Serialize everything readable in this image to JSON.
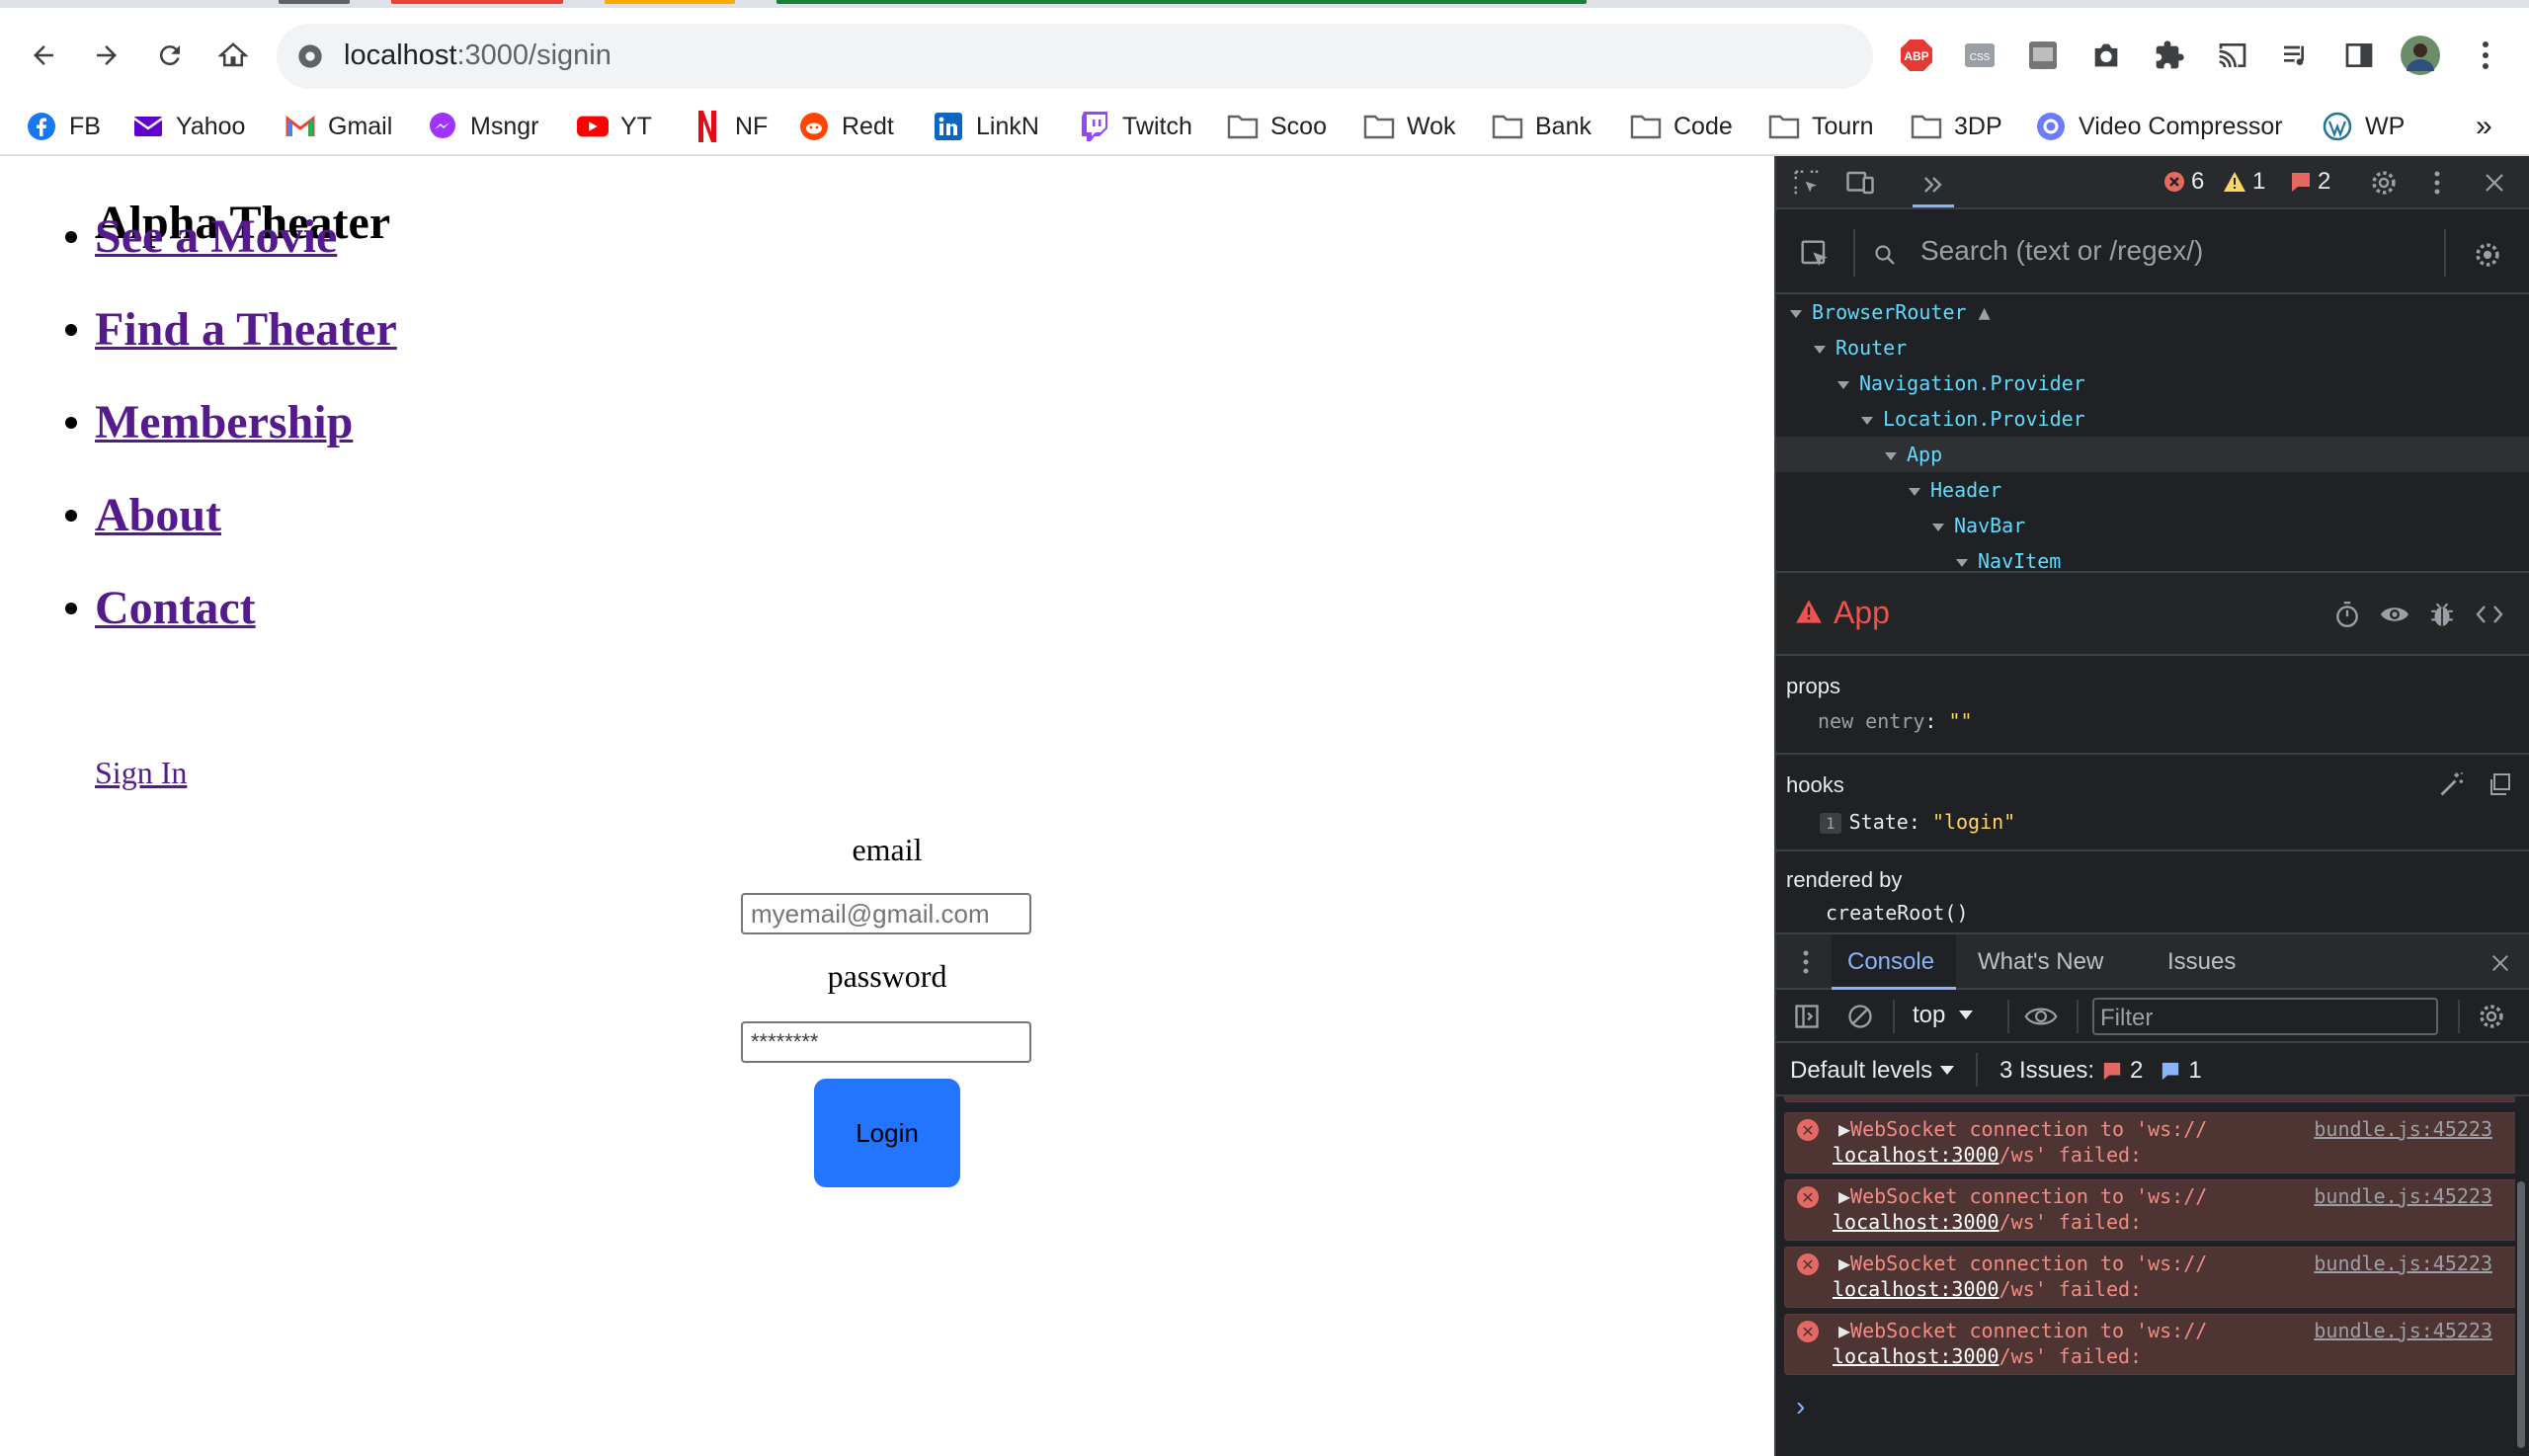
{
  "browser": {
    "url_host": "localhost",
    "url_path": ":3000/signin",
    "extensions": [
      "abp-icon",
      "css-icon",
      "screenshot-icon",
      "camera-icon",
      "puzzle-icon",
      "cast-icon",
      "playlist-icon",
      "sidepanel-icon",
      "avatar",
      "menu-icon"
    ],
    "abp_label": "ABP",
    "css_label": "CSS",
    "bookmarks": [
      {
        "label": "FB",
        "icon": "facebook-icon",
        "color": "#1877f2"
      },
      {
        "label": "Yahoo",
        "icon": "yahoo-mail-icon",
        "color": "#5f01d1"
      },
      {
        "label": "Gmail",
        "icon": "gmail-icon",
        "color": "#ea4335"
      },
      {
        "label": "Msngr",
        "icon": "messenger-icon",
        "color": "#a033ff"
      },
      {
        "label": "YT",
        "icon": "youtube-icon",
        "color": "#ff0000"
      },
      {
        "label": "NF",
        "icon": "netflix-icon",
        "color": "#e50914"
      },
      {
        "label": "Redt",
        "icon": "reddit-icon",
        "color": "#ff4500"
      },
      {
        "label": "LinkN",
        "icon": "linkedin-icon",
        "color": "#0a66c2"
      },
      {
        "label": "Twitch",
        "icon": "twitch-icon",
        "color": "#9146ff"
      },
      {
        "label": "Scoo",
        "icon": "folder-icon",
        "color": "#5f6368"
      },
      {
        "label": "Wok",
        "icon": "folder-icon",
        "color": "#5f6368"
      },
      {
        "label": "Bank",
        "icon": "folder-icon",
        "color": "#5f6368"
      },
      {
        "label": "Code",
        "icon": "folder-icon",
        "color": "#5f6368"
      },
      {
        "label": "Tourn",
        "icon": "folder-icon",
        "color": "#5f6368"
      },
      {
        "label": "3DP",
        "icon": "folder-icon",
        "color": "#5f6368"
      },
      {
        "label": "Video Compressor",
        "icon": "video-compressor-icon",
        "color": "#6d7cff"
      },
      {
        "label": "WP",
        "icon": "wordpress-icon",
        "color": "#21759b"
      }
    ],
    "more_bookmarks": "»"
  },
  "page": {
    "title": "Alpha Theater",
    "nav_items": [
      "See a Movie",
      "Find a Theater",
      "Membership",
      "About",
      "Contact"
    ],
    "signin_link": "Sign In",
    "email_label": "email",
    "email_placeholder": "myemail@gmail.com",
    "password_label": "password",
    "password_value": "********",
    "login_button": "Login",
    "link_color": "#551a8b",
    "button_color": "#2374ff"
  },
  "devtools": {
    "error_count": "6",
    "warning_count": "1",
    "issue_count": "2",
    "search_placeholder": "Search (text or /regex/)",
    "tree": [
      {
        "name": "BrowserRouter",
        "depth": 0,
        "warning": true
      },
      {
        "name": "Router",
        "depth": 1
      },
      {
        "name": "Navigation.Provider",
        "depth": 2
      },
      {
        "name": "Location.Provider",
        "depth": 3
      },
      {
        "name": "App",
        "depth": 4,
        "selected": true
      },
      {
        "name": "Header",
        "depth": 5
      },
      {
        "name": "NavBar",
        "depth": 6
      },
      {
        "name": "NavItem",
        "depth": 7
      }
    ],
    "selected_component": "App",
    "props_title": "props",
    "props_new_entry_key": "new entry",
    "props_new_entry_value": "\"\"",
    "hooks_title": "hooks",
    "hook_index": "1",
    "hook_name": "State:",
    "hook_value": "\"login\"",
    "rendered_by_title": "rendered by",
    "rendered_by_value": "createRoot()",
    "console_tabs": [
      "Console",
      "What's New",
      "Issues"
    ],
    "context": "top",
    "filter_placeholder": "Filter",
    "default_levels": "Default levels",
    "issues_label": "3 Issues:",
    "issues_errors": "2",
    "issues_info": "1",
    "messages": [
      {
        "line1": "WebSocket connection to 'ws://",
        "line2_host": "localhost:3000",
        "line2_rest": "/ws' failed:",
        "source": "bundle.js:45223"
      },
      {
        "line1": "WebSocket connection to 'ws://",
        "line2_host": "localhost:3000",
        "line2_rest": "/ws' failed:",
        "source": "bundle.js:45223"
      },
      {
        "line1": "WebSocket connection to 'ws://",
        "line2_host": "localhost:3000",
        "line2_rest": "/ws' failed:",
        "source": "bundle.js:45223"
      },
      {
        "line1": "WebSocket connection to 'ws://",
        "line2_host": "localhost:3000",
        "line2_rest": "/ws' failed:",
        "source": "bundle.js:45223"
      }
    ],
    "prompt": "›"
  }
}
